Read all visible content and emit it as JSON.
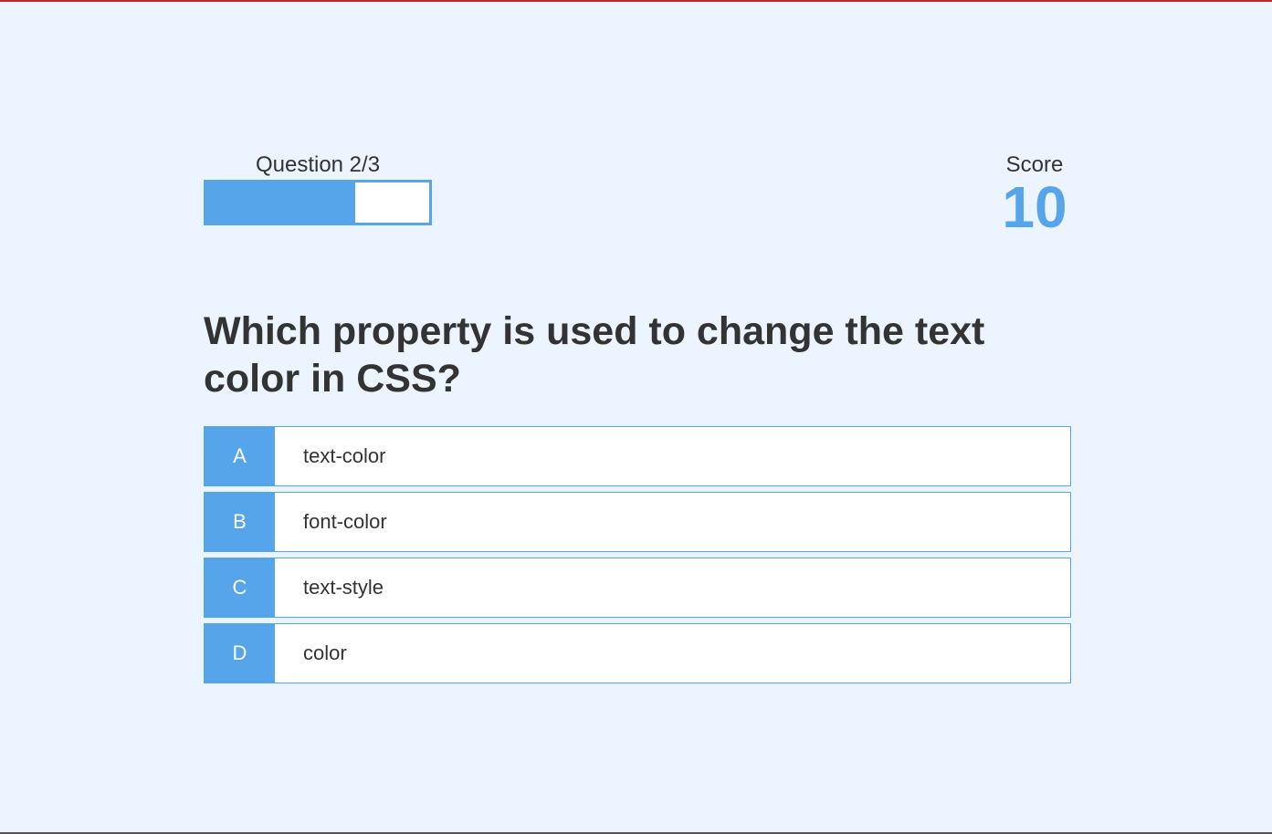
{
  "hud": {
    "progress_text": "Question 2/3",
    "progress_fraction": 0.6667,
    "score_label": "Score",
    "score_value": "10"
  },
  "question": {
    "text": "Which property is used to change the text color in CSS?"
  },
  "choices": [
    {
      "prefix": "A",
      "text": "text-color"
    },
    {
      "prefix": "B",
      "text": "font-color"
    },
    {
      "prefix": "C",
      "text": "text-style"
    },
    {
      "prefix": "D",
      "text": "color"
    }
  ],
  "colors": {
    "accent": "#56a5eb",
    "background": "#ebf4ff",
    "text": "#333333"
  }
}
